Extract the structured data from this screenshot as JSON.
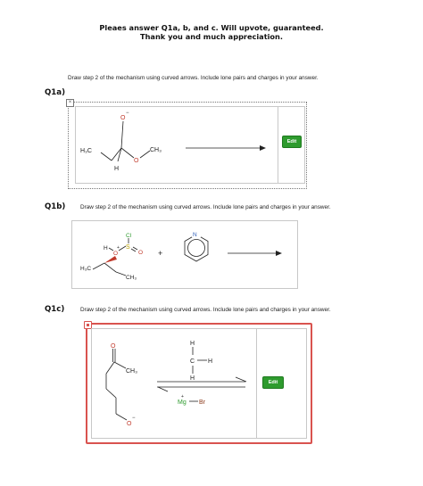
{
  "header": {
    "line1": "Pleaes answer Q1a, b, and c. Will upvote, guaranteed.",
    "line2": "Thank you and much appreciation."
  },
  "q1a": {
    "instruction": "Draw step 2 of the mechanism using curved arrows. Include lone pairs and charges in your answer.",
    "label": "Q1a)",
    "edit_label": "Edit",
    "close_glyph": "×",
    "molecule": {
      "o_minus": "O",
      "o_ether": "O",
      "h3c": "H₃C",
      "ch3": "CH₃",
      "h": "H",
      "minus": "−"
    }
  },
  "q1b": {
    "label": "Q1b)",
    "instruction": "Draw step 2 of the mechanism using curved arrows. Include lone pairs and charges in your answer.",
    "molecule": {
      "cl": "Cl",
      "s": "S",
      "o_eq": "O",
      "o_plus": "O",
      "h": "H",
      "plus_charge": "+",
      "h3c": "H₃C",
      "ch3": "CH₃",
      "n": "N",
      "plus_sign": "+"
    }
  },
  "q1c": {
    "label": "Q1c)",
    "instruction": "Draw step 2 of the mechanism using curved arrows. Include lone pairs and charges in your answer.",
    "edit_label": "Edit",
    "molecule": {
      "o_keto": "O",
      "ch3": "CH₃",
      "o_minus": "O",
      "minus": "−",
      "h_top": "H",
      "c": "C",
      "h_right": "H",
      "h_bottom": "H",
      "mg": "Mg",
      "br": "Br",
      "plus": "+"
    }
  },
  "colors": {
    "edit_green": "#2e9b2e",
    "selected_red": "#d9534f",
    "alkoxide_red": "#c0392b",
    "pyridine_n_blue": "#2f5fb8",
    "cl_green": "#2e9b2e",
    "s_yellow": "#b8a000"
  }
}
